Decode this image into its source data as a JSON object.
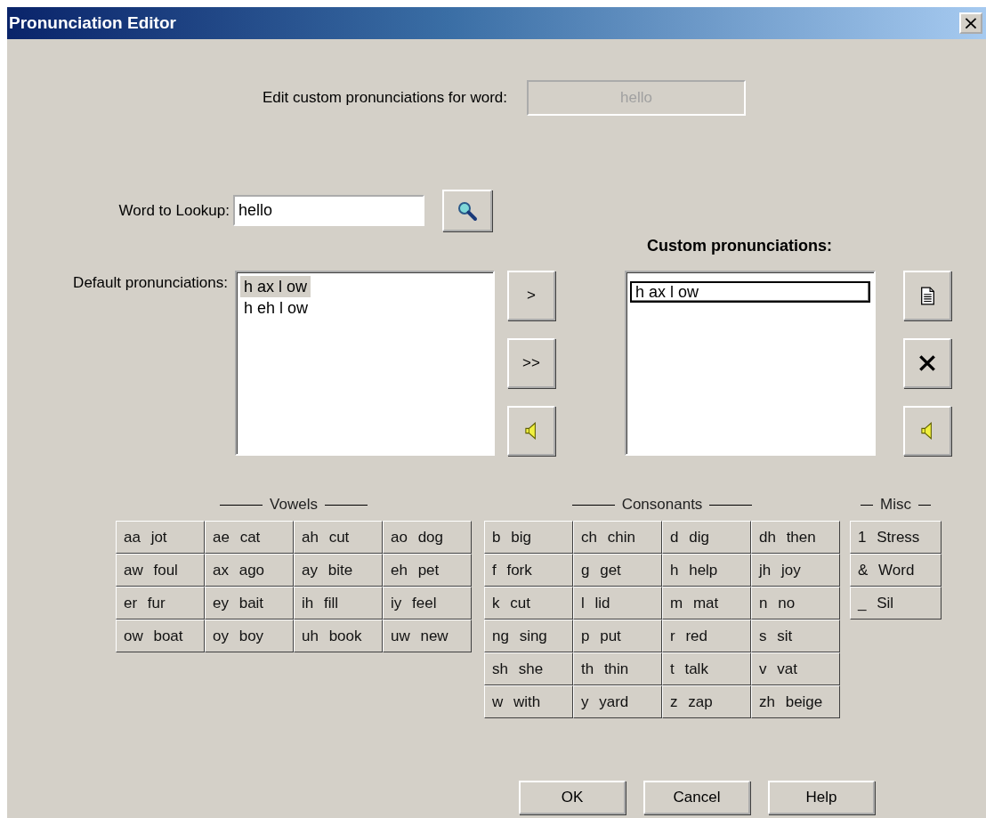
{
  "window": {
    "title": "Pronunciation Editor",
    "close": "×"
  },
  "edit_word": {
    "label": "Edit custom pronunciations for word:",
    "value": "hello",
    "disabled": true
  },
  "lookup": {
    "label": "Word to Lookup:",
    "value": "hello"
  },
  "default_pronunciations": {
    "label": "Default pronunciations:",
    "items": [
      {
        "text": "h ax l ow",
        "selected": true
      },
      {
        "text": "h eh l ow",
        "selected": false
      }
    ]
  },
  "transfer_buttons": [
    {
      "kind": "text",
      "label": ">"
    },
    {
      "kind": "text",
      "label": ">>"
    },
    {
      "kind": "speaker"
    }
  ],
  "custom_pronunciations": {
    "label": "Custom pronunciations:",
    "items": [
      {
        "text": "h ax l ow",
        "editing": true
      }
    ]
  },
  "custom_buttons": [
    {
      "kind": "new"
    },
    {
      "kind": "delete"
    },
    {
      "kind": "speaker"
    }
  ],
  "keypads": [
    {
      "title": "Vowels",
      "kind": "phonemes",
      "keys": [
        "aa jot",
        "ae cat",
        "ah cut",
        "ao dog",
        "aw foul",
        "ax ago",
        "ay bite",
        "eh pet",
        "er fur",
        "ey bait",
        "ih fill",
        "iy feel",
        "ow boat",
        "oy boy",
        "uh book",
        "uw new"
      ]
    },
    {
      "title": "Consonants",
      "kind": "phonemes",
      "keys": [
        "b big",
        "ch chin",
        "d dig",
        "dh then",
        "f fork",
        "g get",
        "h help",
        "jh joy",
        "k cut",
        "l lid",
        "m mat",
        "n no",
        "ng sing",
        "p put",
        "r red",
        "s sit",
        "sh she",
        "th thin",
        "t talk",
        "v vat",
        "w with",
        "y yard",
        "z zap",
        "zh beige"
      ]
    },
    {
      "title": "Misc",
      "kind": "misc",
      "keys": [
        "1 Stress",
        "& Word",
        "_ Sil"
      ]
    }
  ],
  "buttons": [
    "OK",
    "Cancel",
    "Help"
  ]
}
